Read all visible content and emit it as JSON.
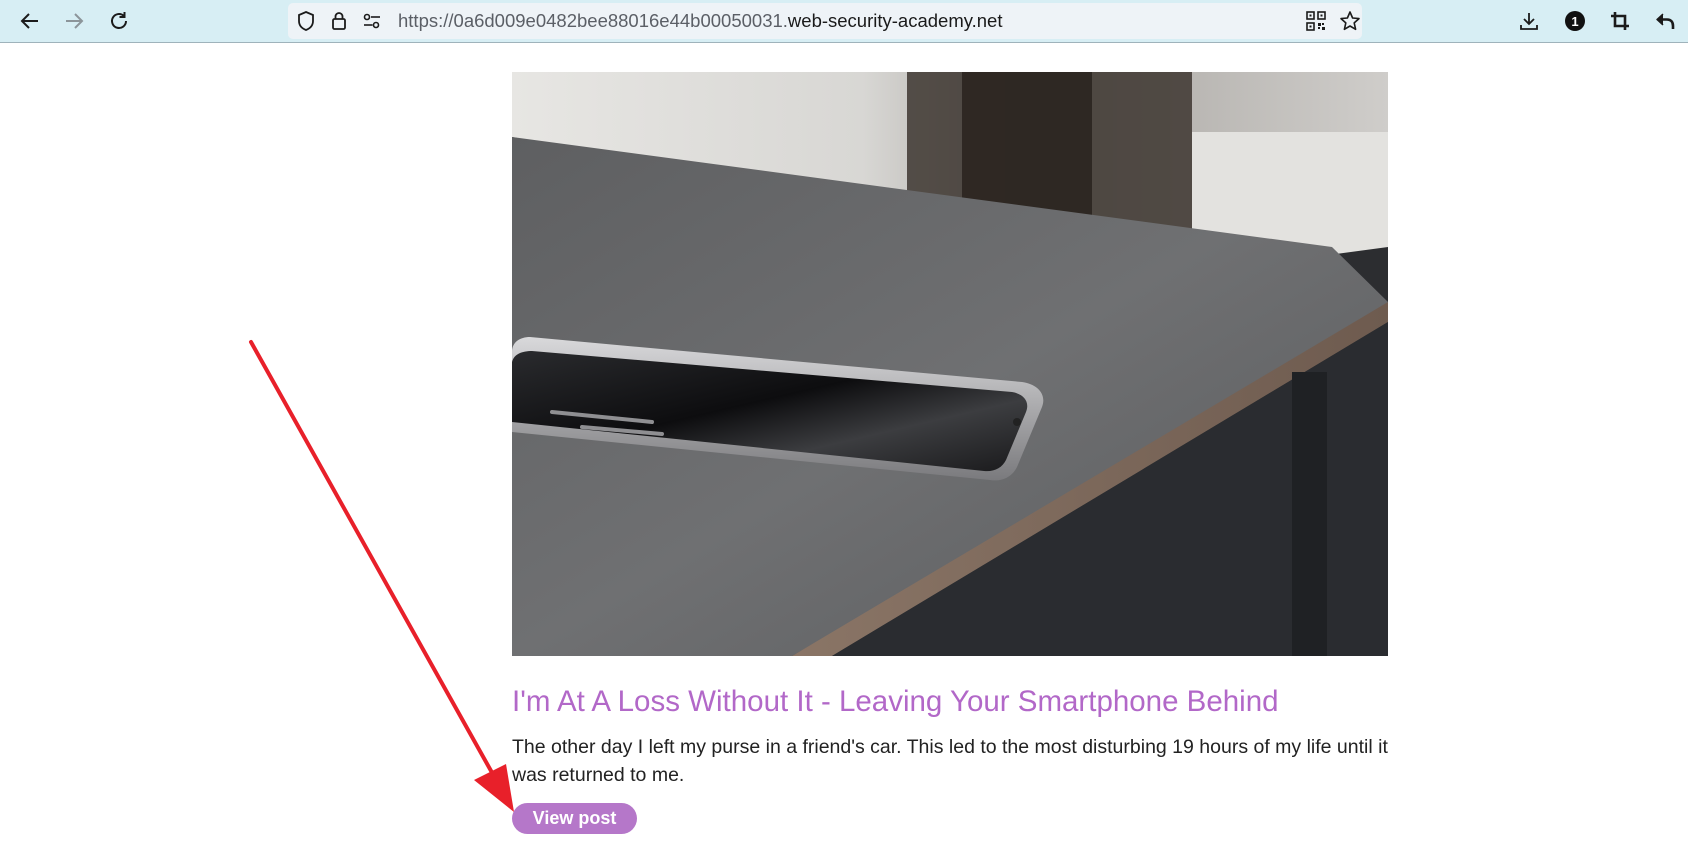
{
  "browser": {
    "url_prefix": "https://0a6d009e0482bee88016e44b00050031.",
    "url_domain": "web-security-academy.net",
    "notification_count": "1"
  },
  "post": {
    "image_alt": "Smartphone lying on the corner of a wooden table",
    "title": "I'm At A Loss Without It - Leaving Your Smartphone Behind",
    "summary": "The other day I left my purse in a friend's car. This led to the most disturbing 19 hours of my life until it was returned to me.",
    "button_label": "View post"
  },
  "colors": {
    "toolbar_bg": "#d7eef4",
    "title_color": "#b268c8",
    "button_bg": "#b577c9",
    "arrow_color": "#e8202a"
  }
}
